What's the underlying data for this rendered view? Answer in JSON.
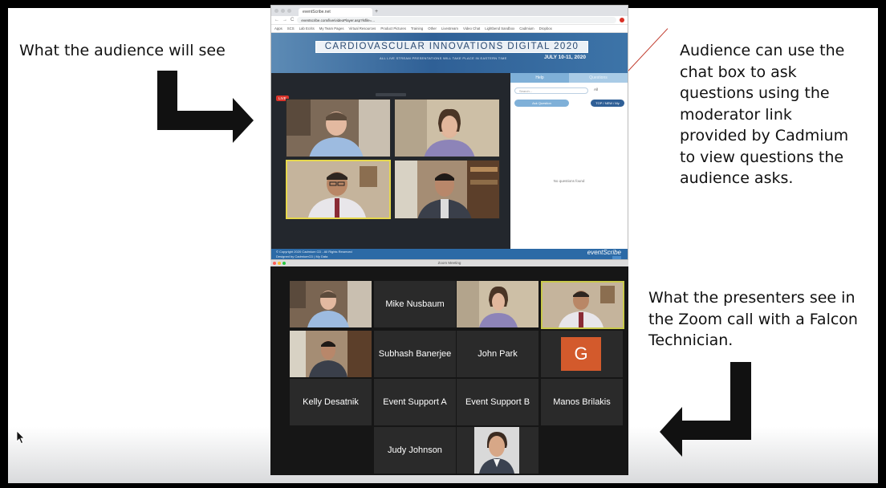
{
  "slide": {
    "caption_left": "What the audience will see",
    "caption_right_top": "Audience can use the chat box to ask questions using the moderator link provided by Cadmium to view questions the audience asks.",
    "caption_right_bottom": "What the presenters see in the Zoom call with a Falcon Technician."
  },
  "browser": {
    "tab_title": "eventScribe.net",
    "tab_add": "+",
    "nav_back": "←",
    "nav_forward": "→",
    "nav_reload": "C",
    "url": "eventscribe.com/live/videoPlayer.asp?lsfile=..."
  },
  "bookmarks": [
    "Apps",
    "SCS",
    "Lab Ecrits",
    "My Team Pages",
    "Virtual Resources",
    "Product Pictures",
    "Training",
    "Other",
    "Livestream",
    "Video Chat",
    "Lightbend Sandbox",
    "Cadmium",
    "Dropbox"
  ],
  "event": {
    "title": "CARDIOVASCULAR INNOVATIONS DIGITAL 2020",
    "subtitle": "ALL LIVE STREAM PRESENTATIONS WILL TAKE PLACE IN EASTERN TIME",
    "dates": "JULY 10-11, 2020",
    "live_badge": "LIVE"
  },
  "qa": {
    "tab_active": "Help",
    "tab_inactive": "Questions",
    "search_placeholder": "Search...",
    "filter_label": "All",
    "ask_button": "Ask Question",
    "sort_button": "TOP / NEW / My",
    "empty_text": "No questions found"
  },
  "site_footer": {
    "copyright": "© Copyright 2020 Cadmium CD - All Rights Reserved",
    "links": "Designed by CadmiumCD  |  My Data",
    "brand": "eventScribe"
  },
  "zoom": {
    "window_title": "Zoom Meeting",
    "participants": {
      "mike_nusbaum": "Mike Nusbaum",
      "subhash_banerjee": "Subhash Banerjee",
      "john_park": "John Park",
      "kelly_desatnik": "Kelly Desatnik",
      "event_support_a": "Event Support A",
      "event_support_b": "Event Support B",
      "manos_brilakis": "Manos Brilakis",
      "judy_johnson": "Judy Johnson",
      "g_avatar": "G"
    }
  },
  "colors": {
    "arrow": "#111111",
    "connector": "#c0392b",
    "zoom_bg": "#161616",
    "zoom_tile": "#2a2a2a",
    "avatar_orange": "#d35a2c",
    "site_blue": "#2c6aa6"
  },
  "icons": {
    "arrow_right": "l-shaped-arrow-right",
    "arrow_left": "l-shaped-arrow-left",
    "pointer": "mouse-pointer"
  }
}
